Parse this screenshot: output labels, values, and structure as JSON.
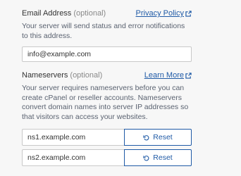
{
  "email": {
    "label": "Email Address",
    "optional": "(optional)",
    "link": "Privacy Policy",
    "description": "Your server will send status and error notifications to this address.",
    "value": "info@example.com"
  },
  "nameservers": {
    "label": "Nameservers",
    "optional": "(optional)",
    "link": "Learn More",
    "description": "Your server requires nameservers before you can create cPanel or reseller accounts. Nameservers convert domain names into server IP addresses so that visitors can access your websites.",
    "rows": [
      {
        "value": "ns1.example.com",
        "reset_label": "Reset"
      },
      {
        "value": "ns2.example.com",
        "reset_label": "Reset"
      }
    ]
  },
  "icons": {
    "external": "external-link-icon",
    "reset": "undo-icon"
  },
  "colors": {
    "link": "#1f5aa6",
    "background": "#f7f7f7"
  }
}
